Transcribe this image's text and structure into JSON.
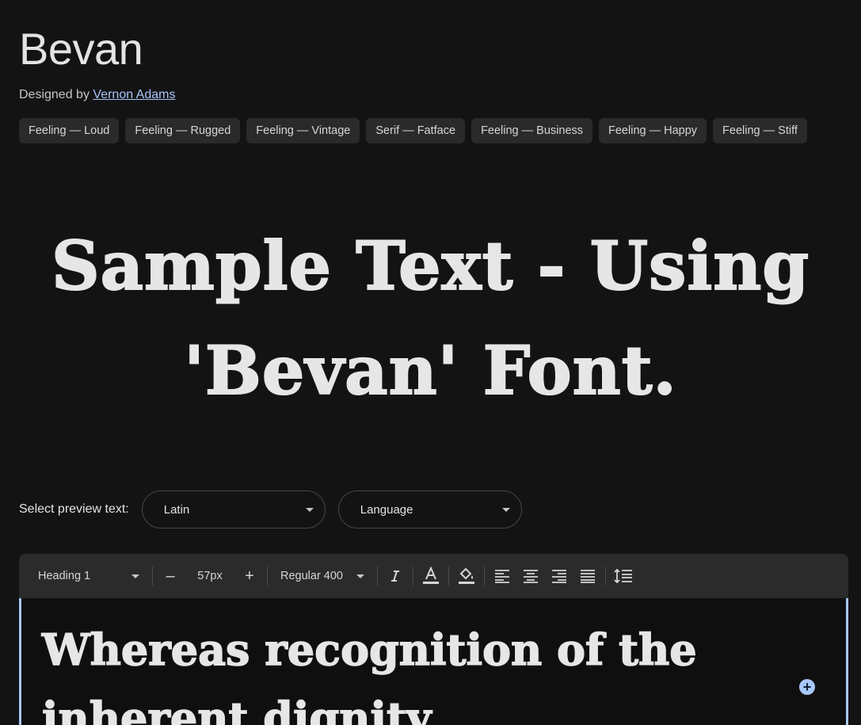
{
  "font": {
    "name": "Bevan",
    "designed_by_prefix": "Designed by",
    "designer": "Vernon Adams"
  },
  "tags": [
    "Feeling — Loud",
    "Feeling — Rugged",
    "Feeling — Vintage",
    "Serif — Fatface",
    "Feeling — Business",
    "Feeling — Happy",
    "Feeling — Stiff"
  ],
  "hero": {
    "line1": "Sample Text - Using",
    "line2": "'Bevan' Font."
  },
  "preview": {
    "label": "Select preview text:",
    "script_value": "Latin",
    "language_value": "Language"
  },
  "toolbar": {
    "style_value": "Heading 1",
    "decrease_label": "–",
    "size_value": "57px",
    "increase_label": "+",
    "weight_value": "Regular 400"
  },
  "editor": {
    "line1": "Whereas recognition of the",
    "line2": "inherent dignity"
  },
  "colors": {
    "background": "#131313",
    "accent": "#a8c7fa",
    "chip": "#2a2a2a"
  }
}
